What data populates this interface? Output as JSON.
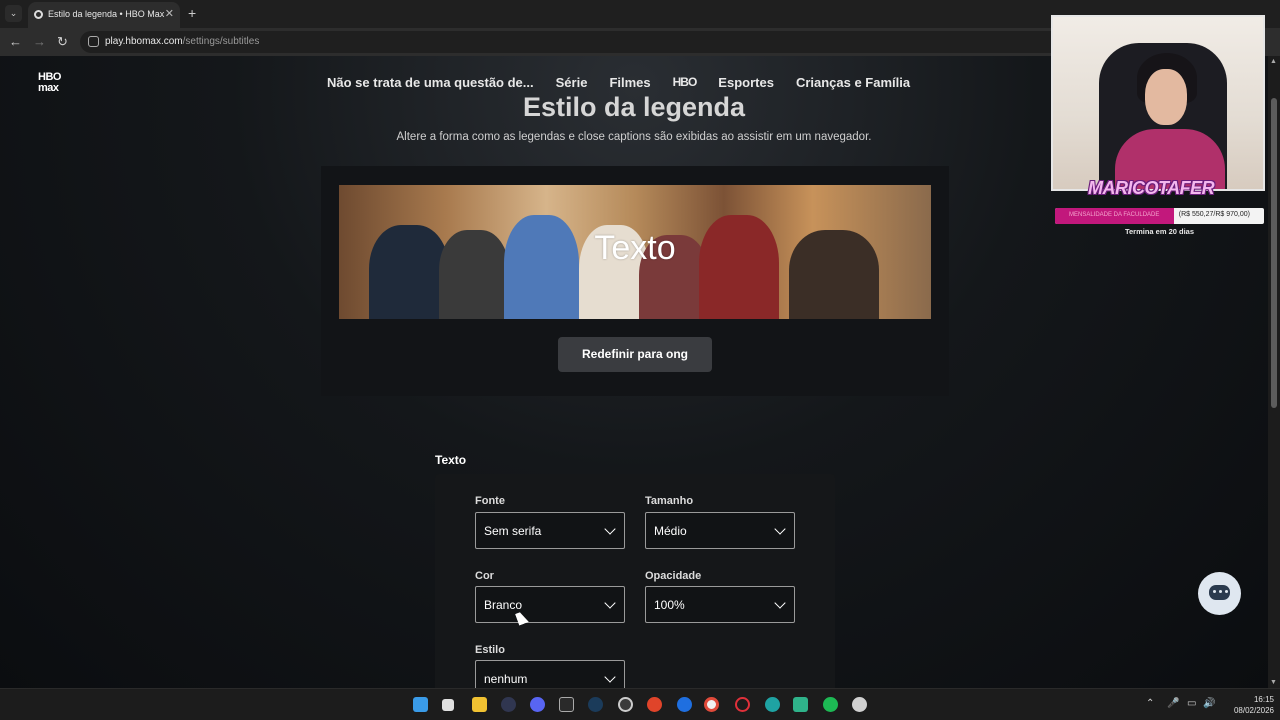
{
  "browser": {
    "tab_title": "Estilo da legenda • HBO Max",
    "url_host": "play.hbomax.com",
    "url_path": "/settings/subtitles"
  },
  "site": {
    "logo_top": "HBO",
    "logo_bottom": "max",
    "nav": [
      "Não se trata de uma questão de...",
      "Série",
      "Filmes",
      "HBO",
      "Esportes",
      "Crianças e Família"
    ]
  },
  "settings": {
    "title": "Estilo da legenda",
    "subtitle": "Altere a forma como as legendas e close captions são exibidas ao assistir em um navegador.",
    "preview_text": "Texto",
    "reset_label": "Redefinir para ong",
    "section_label": "Texto",
    "fields": {
      "fonte": {
        "label": "Fonte",
        "value": "Sem serifa"
      },
      "tamanho": {
        "label": "Tamanho",
        "value": "Médio"
      },
      "cor": {
        "label": "Cor",
        "value": "Branco"
      },
      "opacidade": {
        "label": "Opacidade",
        "value": "100%"
      },
      "estilo": {
        "label": "Estilo",
        "value": "nenhum"
      }
    }
  },
  "overlay": {
    "streamer_name": "MARICOTAFER",
    "goal_label": "MENSALIDADE DA FACULDADE",
    "goal_amount": "(R$ 550,27/R$ 970,00)",
    "goal_progress": 0.567,
    "goal_remaining": "Termina em 20 dias"
  },
  "taskbar": {
    "time": "16:15",
    "date": "08/02/2026"
  },
  "colors": {
    "goal_fill": "#c2187c",
    "page_bg": "#0d0f12"
  }
}
